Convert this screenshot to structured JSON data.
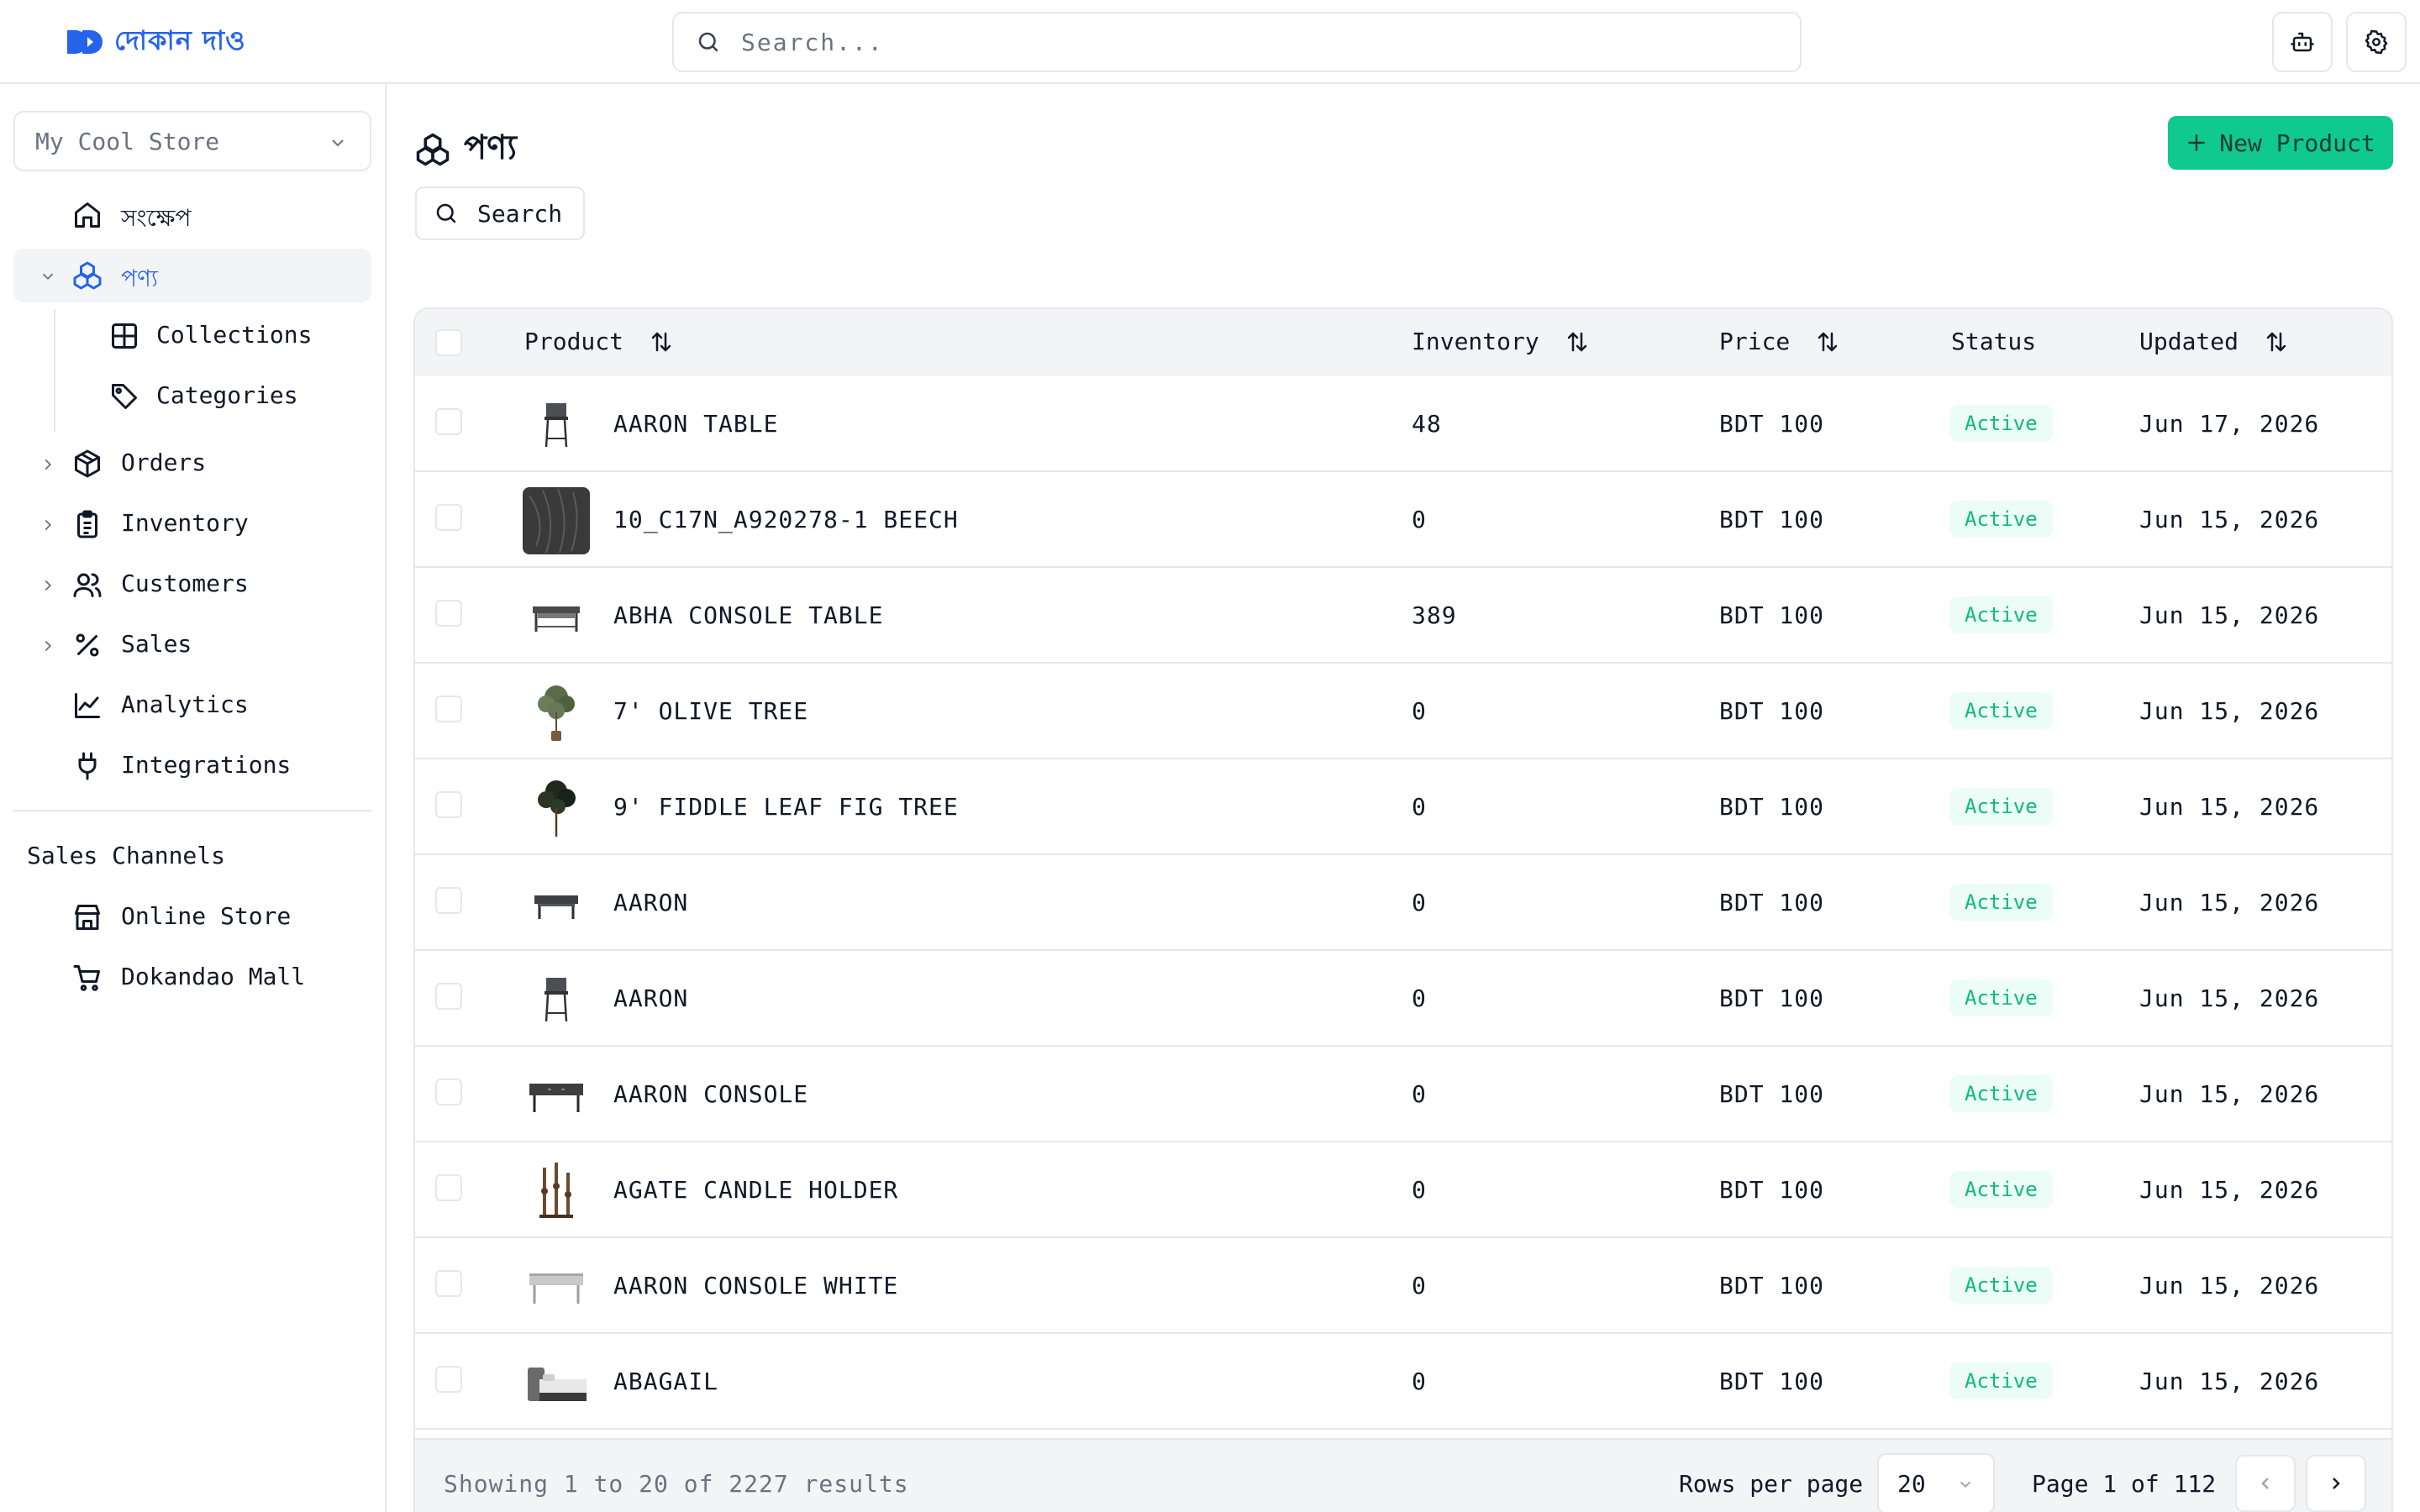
{
  "app": {
    "brand": "দোকান দাও",
    "brand_color": "#2563eb",
    "accent_color": "#10c98f"
  },
  "header": {
    "search_placeholder": "Search...",
    "actions": [
      {
        "icon": "bot-icon"
      },
      {
        "icon": "gear-icon"
      }
    ]
  },
  "sidebar": {
    "store": "My Cool Store",
    "items": [
      {
        "label": "সংক্ষেপ",
        "icon": "home-icon"
      },
      {
        "label": "পণ্য",
        "icon": "products-icon",
        "active": true,
        "expanded": true
      },
      {
        "label": "Collections",
        "icon": "grid-icon",
        "sub": true
      },
      {
        "label": "Categories",
        "icon": "tag-icon",
        "sub": true
      },
      {
        "label": "Orders",
        "icon": "box-icon"
      },
      {
        "label": "Inventory",
        "icon": "clipboard-icon"
      },
      {
        "label": "Customers",
        "icon": "users-icon"
      },
      {
        "label": "Sales",
        "icon": "percent-icon"
      },
      {
        "label": "Analytics",
        "icon": "chart-line-icon"
      },
      {
        "label": "Integrations",
        "icon": "plug-icon"
      }
    ],
    "channels_title": "Sales Channels",
    "channels": [
      {
        "label": "Online Store",
        "icon": "store-icon"
      },
      {
        "label": "Dokandao Mall",
        "icon": "cart-icon"
      }
    ]
  },
  "main": {
    "title": "পণ্য",
    "new_button": "New Product",
    "search_button": "Search",
    "columns": {
      "product": "Product",
      "inventory": "Inventory",
      "price": "Price",
      "status": "Status",
      "updated": "Updated"
    },
    "rows": [
      {
        "name": "AARON TABLE",
        "inventory": "48",
        "price": "BDT 100",
        "status": "Active",
        "updated": "Jun 17, 2026",
        "thumb": "stool"
      },
      {
        "name": "10_C17N_A920278-1 BEECH",
        "inventory": "0",
        "price": "BDT 100",
        "status": "Active",
        "updated": "Jun 15, 2026",
        "thumb": "wood"
      },
      {
        "name": "ABHA CONSOLE TABLE",
        "inventory": "389",
        "price": "BDT 100",
        "status": "Active",
        "updated": "Jun 15, 2026",
        "thumb": "console"
      },
      {
        "name": "7' OLIVE TREE",
        "inventory": "0",
        "price": "BDT 100",
        "status": "Active",
        "updated": "Jun 15, 2026",
        "thumb": "tree"
      },
      {
        "name": "9' FIDDLE LEAF FIG TREE",
        "inventory": "0",
        "price": "BDT 100",
        "status": "Active",
        "updated": "Jun 15, 2026",
        "thumb": "tree-dark"
      },
      {
        "name": "AARON",
        "inventory": "0",
        "price": "BDT 100",
        "status": "Active",
        "updated": "Jun 15, 2026",
        "thumb": "bench"
      },
      {
        "name": "AARON",
        "inventory": "0",
        "price": "BDT 100",
        "status": "Active",
        "updated": "Jun 15, 2026",
        "thumb": "stool"
      },
      {
        "name": "AARON CONSOLE",
        "inventory": "0",
        "price": "BDT 100",
        "status": "Active",
        "updated": "Jun 15, 2026",
        "thumb": "console-dark"
      },
      {
        "name": "AGATE CANDLE HOLDER",
        "inventory": "0",
        "price": "BDT 100",
        "status": "Active",
        "updated": "Jun 15, 2026",
        "thumb": "candles"
      },
      {
        "name": "AARON CONSOLE WHITE",
        "inventory": "0",
        "price": "BDT 100",
        "status": "Active",
        "updated": "Jun 15, 2026",
        "thumb": "console-white"
      },
      {
        "name": "ABAGAIL",
        "inventory": "0",
        "price": "BDT 100",
        "status": "Active",
        "updated": "Jun 15, 2026",
        "thumb": "bed"
      }
    ],
    "footer": {
      "showing": "Showing 1 to 20 of 2227 results",
      "rows_per_page_label": "Rows per page",
      "rows_per_page": "20",
      "page_info": "Page 1 of 112"
    }
  }
}
